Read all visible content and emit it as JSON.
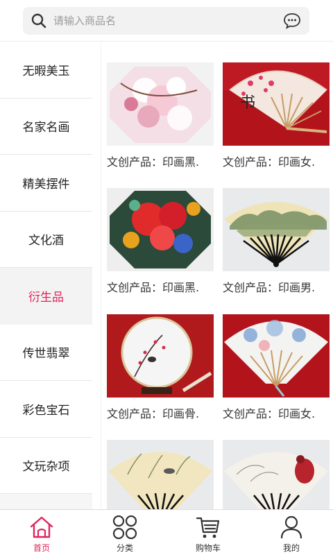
{
  "search": {
    "placeholder": "请输入商品名"
  },
  "categories": [
    {
      "label": "无暇美玉"
    },
    {
      "label": "名家名画"
    },
    {
      "label": "精美摆件"
    },
    {
      "label": "文化酒"
    },
    {
      "label": "衍生品",
      "active": true
    },
    {
      "label": "传世翡翠"
    },
    {
      "label": "彩色宝石"
    },
    {
      "label": "文玩杂项"
    }
  ],
  "products": [
    {
      "caption": "文创产品：印画黑.",
      "image": "umbrella-blossom-image"
    },
    {
      "caption": "文创产品：印画女.",
      "image": "fan-plum-image"
    },
    {
      "caption": "文创产品：印画黑.",
      "image": "umbrella-peony-image"
    },
    {
      "caption": "文创产品：印画男.",
      "image": "fan-landscape-image"
    },
    {
      "caption": "文创产品：印画骨.",
      "image": "plate-bird-image"
    },
    {
      "caption": "文创产品：印画女.",
      "image": "fan-blue-image"
    },
    {
      "caption": "",
      "image": "fan-bamboo-image"
    },
    {
      "caption": "",
      "image": "fan-bird-image"
    }
  ],
  "tabs": [
    {
      "label": "首页",
      "icon": "home-icon",
      "active": true
    },
    {
      "label": "分类",
      "icon": "category-icon"
    },
    {
      "label": "购物车",
      "icon": "cart-icon"
    },
    {
      "label": "我的",
      "icon": "user-icon"
    }
  ],
  "colors": {
    "accent": "#e0245e",
    "sidebar_bg": "#f6f6f6"
  }
}
